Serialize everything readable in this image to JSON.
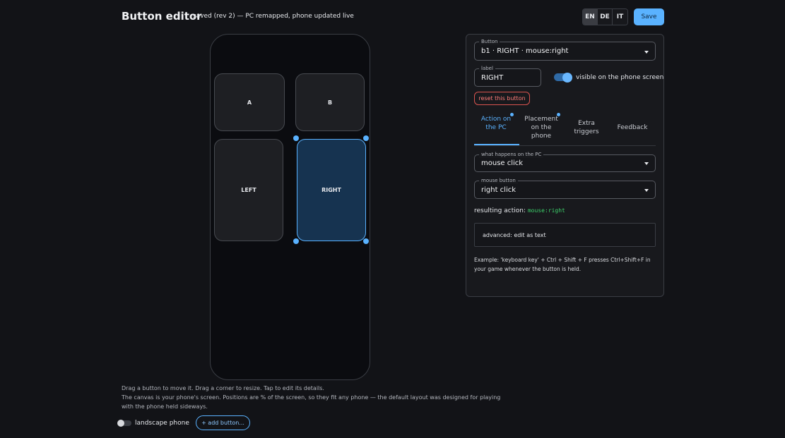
{
  "header": {
    "title": "Button editor",
    "status": "saved (rev 2) — PC remapped, phone updated live",
    "languages": [
      "EN",
      "DE",
      "IT"
    ],
    "active_language": "EN",
    "save_label": "Save"
  },
  "canvas": {
    "buttons": [
      {
        "label": "A"
      },
      {
        "label": "B"
      },
      {
        "label": "LEFT"
      },
      {
        "label": "RIGHT",
        "selected": true
      }
    ],
    "hint_line1": "Drag a button to move it. Drag a corner to resize. Tap to edit its details.",
    "hint_line2": "The canvas is your phone's screen. Positions are % of the screen, so they fit any phone — the default layout was designed for playing",
    "hint_line3": "with the phone held sideways.",
    "landscape_label": "landscape phone",
    "landscape_on": false,
    "add_button_label": "+ add button..."
  },
  "editor": {
    "button_select": {
      "legend": "Button",
      "value": "b1 · RIGHT · mouse:right"
    },
    "label_field": {
      "legend": "label",
      "value": "RIGHT"
    },
    "visible_label": "visible on the phone screen",
    "visible_on": true,
    "reset_label": "reset this button",
    "tabs": [
      {
        "label": "Action on the PC",
        "active": true,
        "dot": true
      },
      {
        "label": "Placement on the phone",
        "active": false,
        "dot": true
      },
      {
        "label": "Extra triggers",
        "active": false,
        "dot": false
      },
      {
        "label": "Feedback",
        "active": false,
        "dot": false
      }
    ],
    "action_select": {
      "legend": "what happens on the PC",
      "value": "mouse click"
    },
    "mouse_select": {
      "legend": "mouse button",
      "value": "right click"
    },
    "result_label": "resulting action:",
    "result_code": "mouse:right",
    "advanced_label": "advanced: edit as text",
    "example_text": "Example: 'keyboard key' + Ctrl + Shift + F presses Ctrl+Shift+F in your game whenever the button is held."
  },
  "colors": {
    "accent": "#5ab2ff",
    "danger": "#d9534f",
    "code": "#3ccf6a"
  }
}
